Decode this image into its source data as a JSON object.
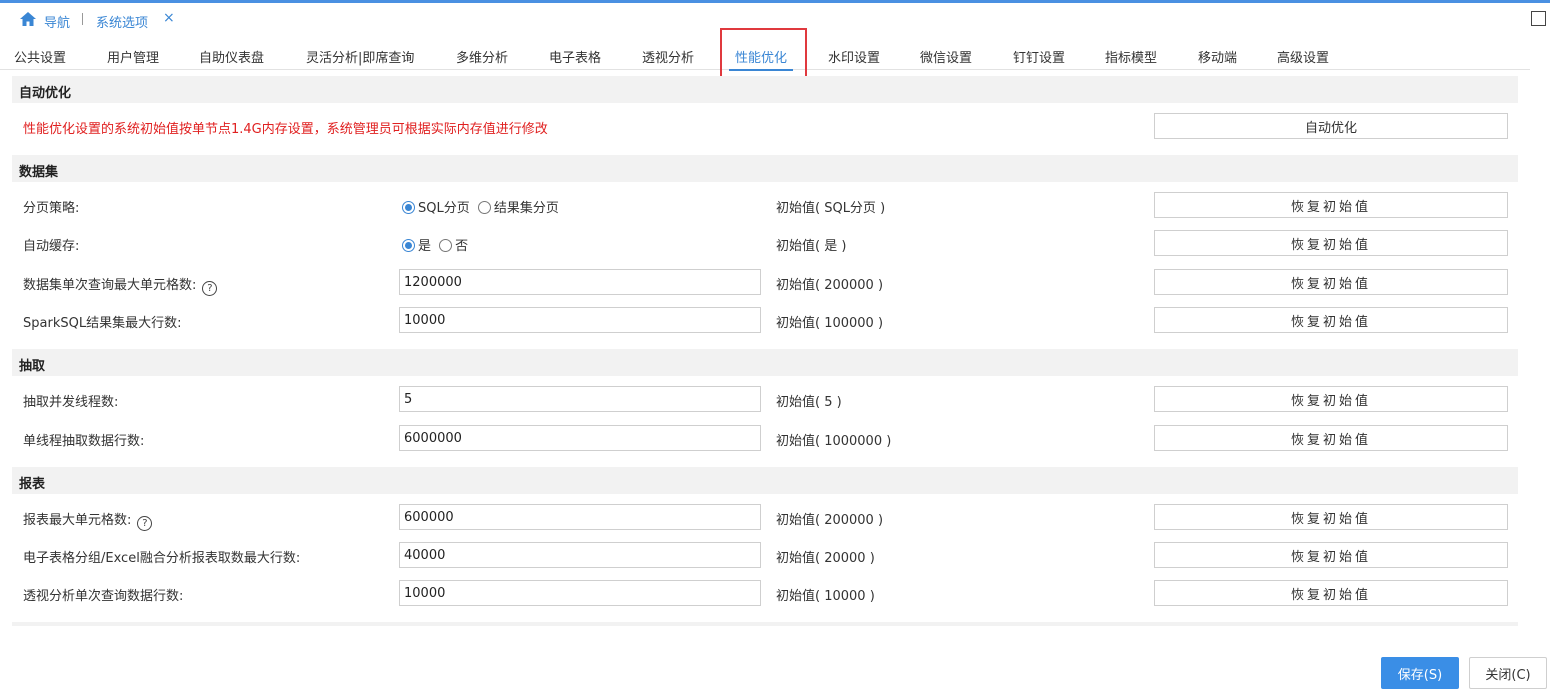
{
  "nav": {
    "home_label": "导航",
    "tab_label": "系统选项",
    "close_glyph": "×"
  },
  "tabs": [
    {
      "label": "公共设置"
    },
    {
      "label": "用户管理"
    },
    {
      "label": "自助仪表盘"
    },
    {
      "label": "灵活分析|即席查询"
    },
    {
      "label": "多维分析"
    },
    {
      "label": "电子表格"
    },
    {
      "label": "透视分析"
    },
    {
      "label": "性能优化",
      "active": true
    },
    {
      "label": "水印设置"
    },
    {
      "label": "微信设置"
    },
    {
      "label": "钉钉设置"
    },
    {
      "label": "指标模型"
    },
    {
      "label": "移动端"
    },
    {
      "label": "高级设置"
    }
  ],
  "auto_opt": {
    "title": "自动优化",
    "warning": "性能优化设置的系统初始值按单节点1.4G内存设置，系统管理员可根据实际内存值进行修改",
    "button": "自动优化"
  },
  "dataset": {
    "title": "数据集",
    "paging": {
      "label": "分页策略:",
      "option1": "SQL分页",
      "option2": "结果集分页",
      "init": "初始值( SQL分页 )"
    },
    "cache": {
      "label": "自动缓存:",
      "option1": "是",
      "option2": "否",
      "init": "初始值( 是 )"
    },
    "max_cells": {
      "label": "数据集单次查询最大单元格数:",
      "value": "1200000",
      "init": "初始值( 200000 )"
    },
    "spark_rows": {
      "label": "SparkSQL结果集最大行数:",
      "value": "10000",
      "init": "初始值( 100000 )"
    }
  },
  "extract": {
    "title": "抽取",
    "threads": {
      "label": "抽取并发线程数:",
      "value": "5",
      "init": "初始值( 5 )"
    },
    "rows": {
      "label": "单线程抽取数据行数:",
      "value": "6000000",
      "init": "初始值( 1000000 )"
    }
  },
  "report": {
    "title": "报表",
    "max_cells": {
      "label": "报表最大单元格数:",
      "value": "600000",
      "init": "初始值( 200000 )"
    },
    "excel_rows": {
      "label": "电子表格分组/Excel融合分析报表取数最大行数:",
      "value": "40000",
      "init": "初始值( 20000 )"
    },
    "pivot_rows": {
      "label": "透视分析单次查询数据行数:",
      "value": "10000",
      "init": "初始值( 10000 )"
    }
  },
  "restore_label": "恢复初始值",
  "help_glyph": "?",
  "footer": {
    "save": "保存(S)",
    "close": "关闭(C)"
  },
  "colors": {
    "accent": "#3a86d4",
    "warning": "#e02020",
    "highlight_box": "#e0393e"
  }
}
